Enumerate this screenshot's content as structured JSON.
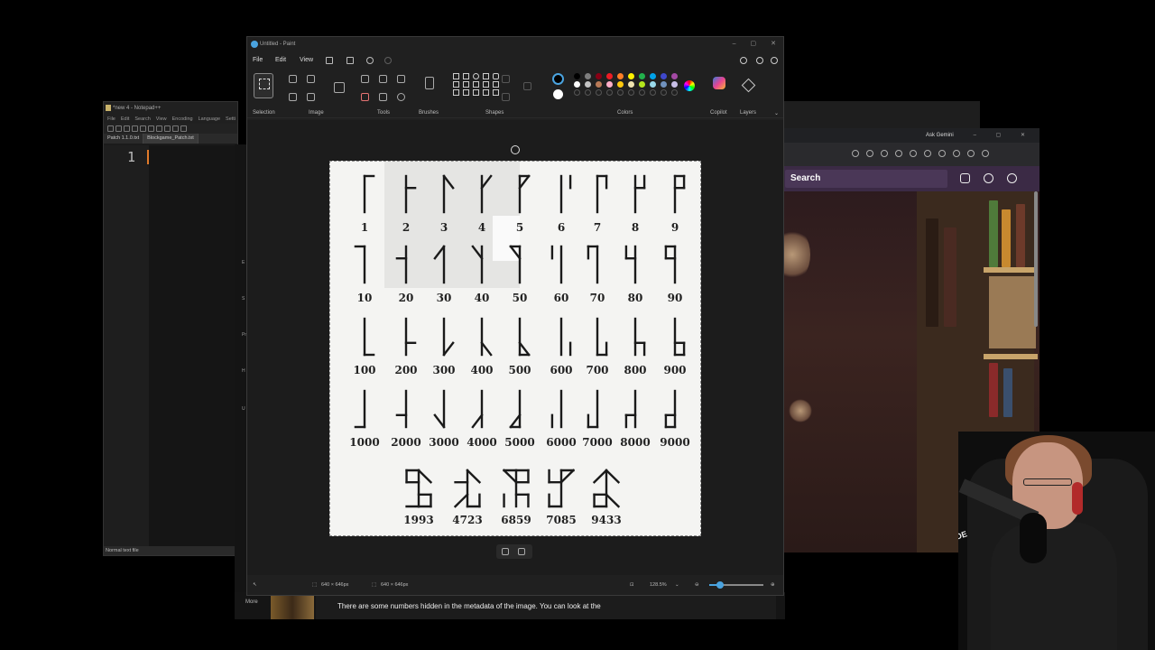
{
  "notepad": {
    "title": "*new 4 - Notepad++",
    "menu": [
      "File",
      "Edit",
      "Search",
      "View",
      "Encoding",
      "Language",
      "Setti"
    ],
    "tabs": [
      "Patch 1.1.0.txt",
      "Blockgame_Patch.txt"
    ],
    "line_number": "1",
    "status": "Normal text file"
  },
  "side_strip": {
    "letters": [
      "E",
      "S",
      "Pr",
      "H",
      "U"
    ]
  },
  "browser": {
    "gemini_label": "Ask Gemini",
    "search_label": "Search"
  },
  "chat": {
    "more_label": "More",
    "message": "There are some numbers hidden in the metadata of the image. You can look at the"
  },
  "paint": {
    "title": "Untitled - Paint",
    "menu": {
      "file": "File",
      "edit": "Edit",
      "view": "View"
    },
    "groups": {
      "selection": "Selection",
      "image": "Image",
      "tools": "Tools",
      "brushes": "Brushes",
      "shapes": "Shapes",
      "colors": "Colors",
      "copilot": "Copilot",
      "layers": "Layers"
    },
    "palette": [
      "#000000",
      "#7f7f7f",
      "#880015",
      "#ed1c24",
      "#ff7f27",
      "#fff200",
      "#22b14c",
      "#00a2e8",
      "#3f48cc",
      "#a349a4",
      "#ffffff",
      "#c3c3c3",
      "#b97a57",
      "#ffaec9",
      "#ffc90e",
      "#efe4b0",
      "#b5e61d",
      "#99d9ea",
      "#7092be",
      "#c8bfe7"
    ],
    "status": {
      "canvas_size": "640 × 646px",
      "selection_size": "640 × 646px",
      "zoom": "128.5%"
    },
    "zoom_fraction": 0.2
  },
  "cistercian": {
    "rows": [
      {
        "labels": [
          "1",
          "2",
          "3",
          "4",
          "5",
          "6",
          "7",
          "8",
          "9"
        ]
      },
      {
        "labels": [
          "10",
          "20",
          "30",
          "40",
          "50",
          "60",
          "70",
          "80",
          "90"
        ]
      },
      {
        "labels": [
          "100",
          "200",
          "300",
          "400",
          "500",
          "600",
          "700",
          "800",
          "900"
        ]
      },
      {
        "labels": [
          "1000",
          "2000",
          "3000",
          "4000",
          "5000",
          "6000",
          "7000",
          "8000",
          "9000"
        ]
      }
    ],
    "examples": [
      "1993",
      "4723",
      "6859",
      "7085",
      "9433"
    ]
  }
}
